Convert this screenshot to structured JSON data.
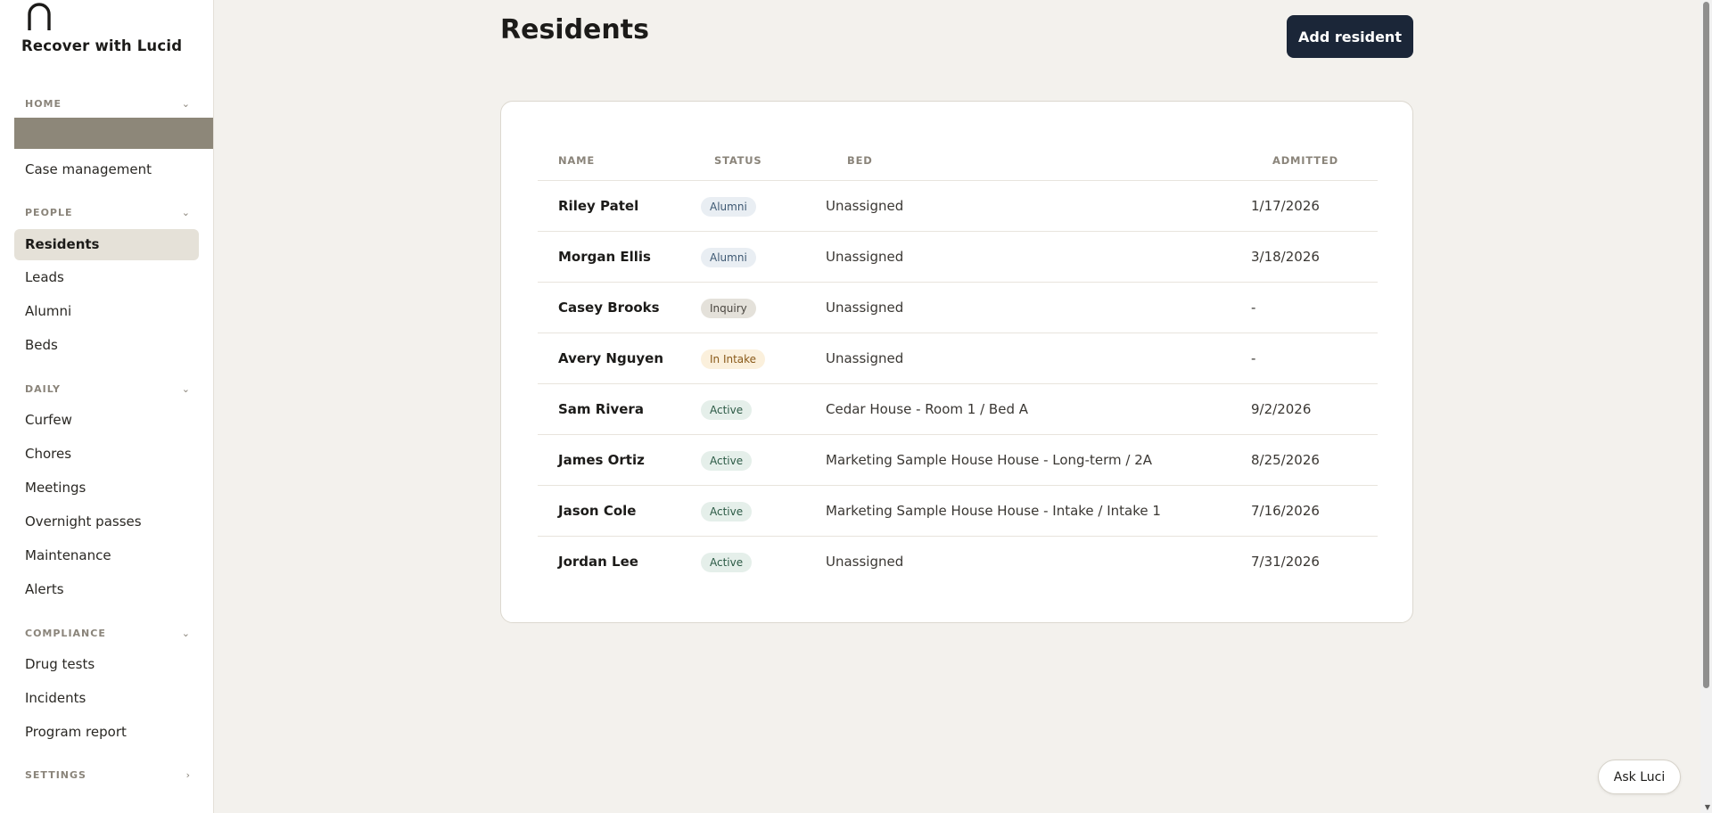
{
  "brand": {
    "name": "Recover with Lucid"
  },
  "sidebar": {
    "sections": {
      "home": {
        "label": "HOME",
        "chevron": "⌄"
      },
      "people": {
        "label": "PEOPLE",
        "chevron": "⌄"
      },
      "daily": {
        "label": "DAILY",
        "chevron": "⌄"
      },
      "compliance": {
        "label": "COMPLIANCE",
        "chevron": "⌄"
      },
      "settings": {
        "label": "SETTINGS",
        "chevron": "›"
      }
    },
    "items": {
      "case_management": "Case management",
      "residents": "Residents",
      "leads": "Leads",
      "alumni": "Alumni",
      "beds": "Beds",
      "curfew": "Curfew",
      "chores": "Chores",
      "meetings": "Meetings",
      "overnight_passes": "Overnight passes",
      "maintenance": "Maintenance",
      "alerts": "Alerts",
      "drug_tests": "Drug tests",
      "incidents": "Incidents",
      "program_report": "Program report"
    }
  },
  "main": {
    "title": "Residents",
    "add_button": "Add resident",
    "table": {
      "headers": {
        "name": "NAME",
        "status": "STATUS",
        "bed": "BED",
        "admitted": "ADMITTED"
      },
      "rows": [
        {
          "name": "Riley Patel",
          "status": "Alumni",
          "bed": "Unassigned",
          "admitted": "1/17/2026"
        },
        {
          "name": "Morgan Ellis",
          "status": "Alumni",
          "bed": "Unassigned",
          "admitted": "3/18/2026"
        },
        {
          "name": "Casey Brooks",
          "status": "Inquiry",
          "bed": "Unassigned",
          "admitted": "-"
        },
        {
          "name": "Avery Nguyen",
          "status": "In Intake",
          "bed": "Unassigned",
          "admitted": "-"
        },
        {
          "name": "Sam Rivera",
          "status": "Active",
          "bed": "Cedar House - Room 1 / Bed A",
          "admitted": "9/2/2026"
        },
        {
          "name": "James Ortiz",
          "status": "Active",
          "bed": "Marketing Sample House House - Long-term / 2A",
          "admitted": "8/25/2026"
        },
        {
          "name": "Jason Cole",
          "status": "Active",
          "bed": "Marketing Sample House House - Intake / Intake 1",
          "admitted": "7/16/2026"
        },
        {
          "name": "Jordan Lee",
          "status": "Active",
          "bed": "Unassigned",
          "admitted": "7/31/2026"
        }
      ]
    }
  },
  "assistant": {
    "label": "Ask Luci"
  },
  "colors": {
    "accent": "#1b2638",
    "page_bg": "#f3f1ed"
  }
}
